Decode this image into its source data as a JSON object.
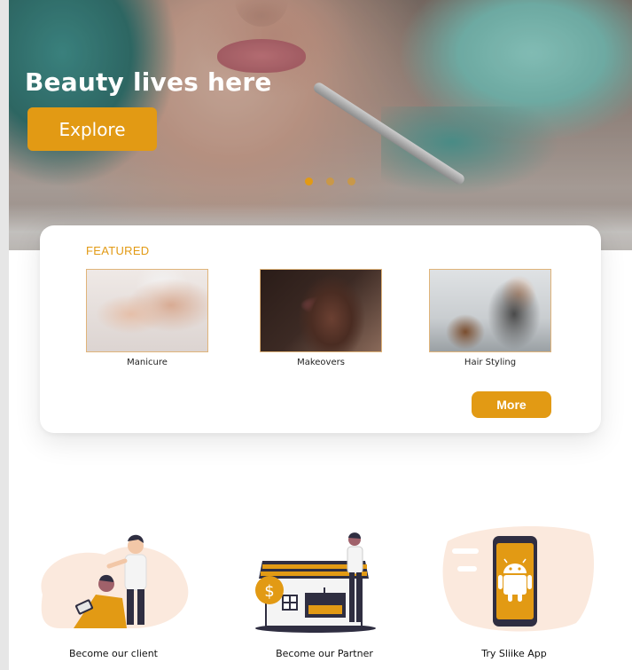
{
  "hero": {
    "title": "Beauty lives here",
    "cta_label": "Explore",
    "slides_total": 3,
    "active_slide": 1
  },
  "featured": {
    "heading": "FEATURED",
    "items": [
      {
        "label": "Manicure"
      },
      {
        "label": "Makeovers"
      },
      {
        "label": "Hair Styling"
      }
    ],
    "more_label": "More"
  },
  "features": [
    {
      "label": "Become our client",
      "icon": "stylist-illustration"
    },
    {
      "label": "Become our Partner",
      "icon": "salon-shop-illustration"
    },
    {
      "label": "Try Sliike App",
      "icon": "android-phone-illustration"
    }
  ],
  "colors": {
    "accent": "#e29a14",
    "dark": "#2f2e41",
    "peach": "#fbe9dd"
  }
}
